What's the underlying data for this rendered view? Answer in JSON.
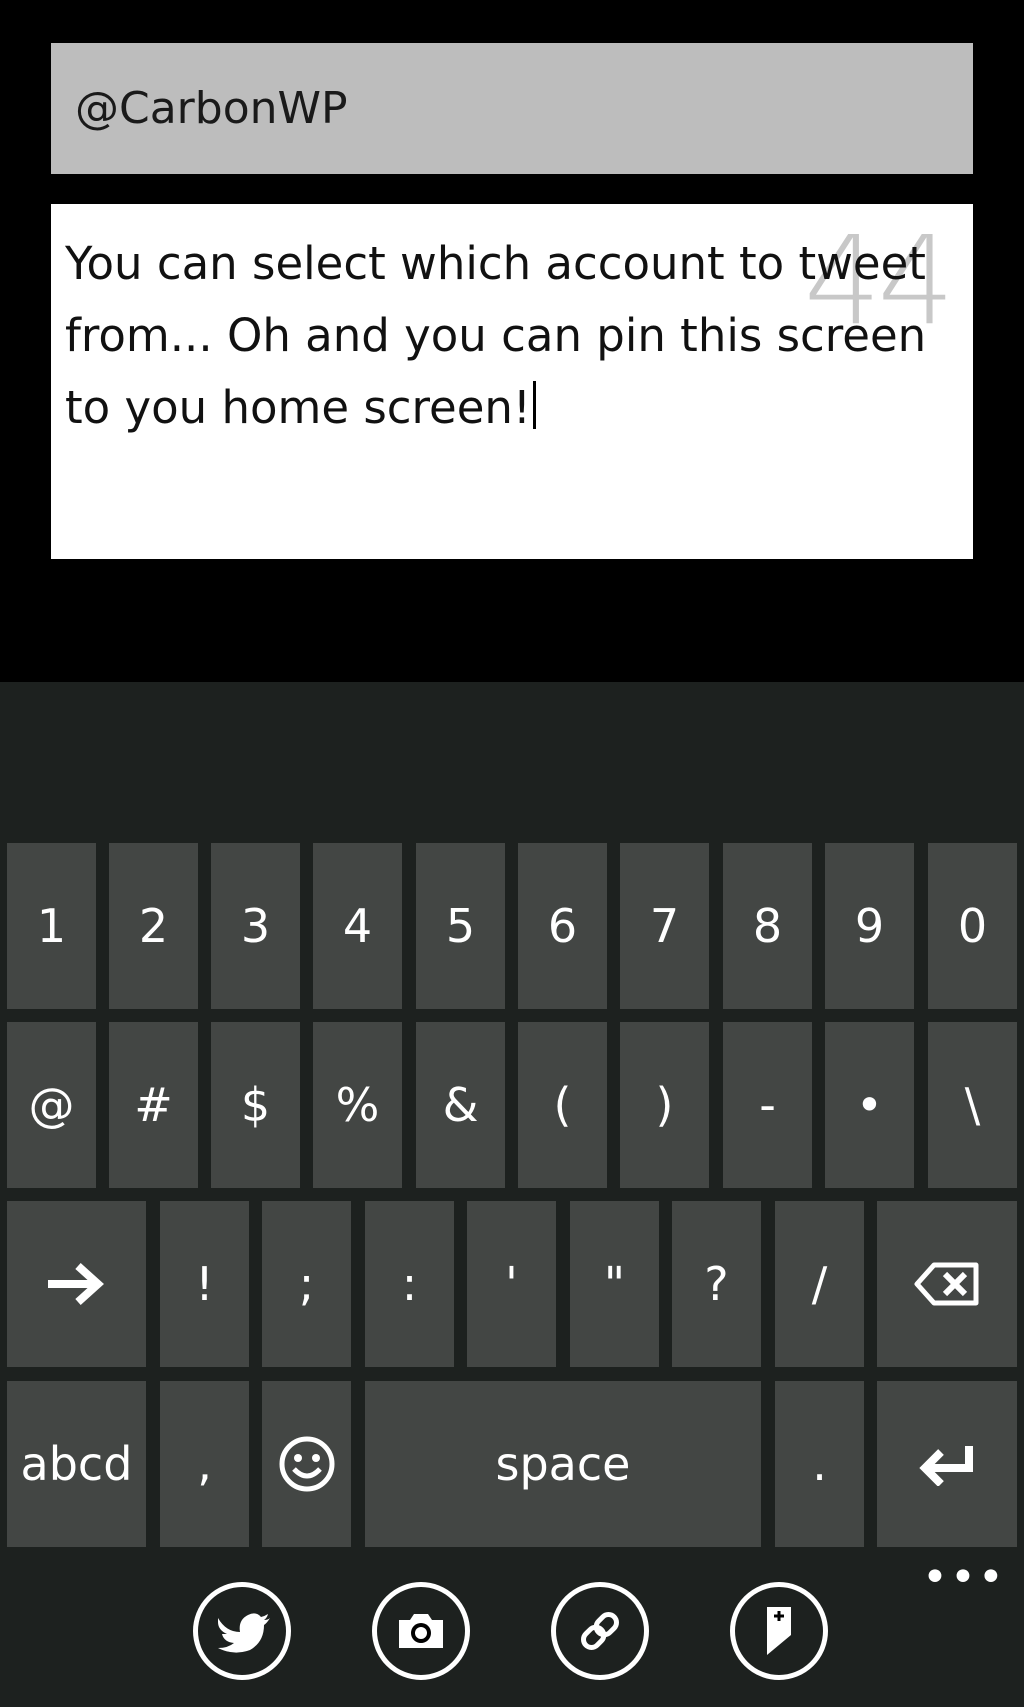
{
  "compose": {
    "account": "@CarbonWP",
    "message": "You can select which account to tweet from... Oh and you can pin this screen to you home screen!",
    "chars_remaining": "44"
  },
  "keyboard": {
    "row1": [
      "1",
      "2",
      "3",
      "4",
      "5",
      "6",
      "7",
      "8",
      "9",
      "0"
    ],
    "row2": [
      "@",
      "#",
      "$",
      "%",
      "&",
      "(",
      ")",
      "-",
      "•",
      "\\"
    ],
    "row3_symbols": [
      "!",
      ";",
      ":",
      "'",
      "\"",
      "?",
      "/"
    ],
    "row4": {
      "abcd": "abcd",
      "comma": ",",
      "space": "space",
      "period": "."
    }
  },
  "app_bar": {
    "more": "•••",
    "buttons": [
      {
        "icon": "twitter-bird-icon"
      },
      {
        "icon": "camera-icon"
      },
      {
        "icon": "link-icon"
      },
      {
        "icon": "pin-icon"
      }
    ]
  },
  "colors": {
    "background": "#000000",
    "keyboard_bg": "#1d211f",
    "key": "#434644",
    "account_field": "#bdbdbd",
    "text_box": "#ffffff"
  }
}
